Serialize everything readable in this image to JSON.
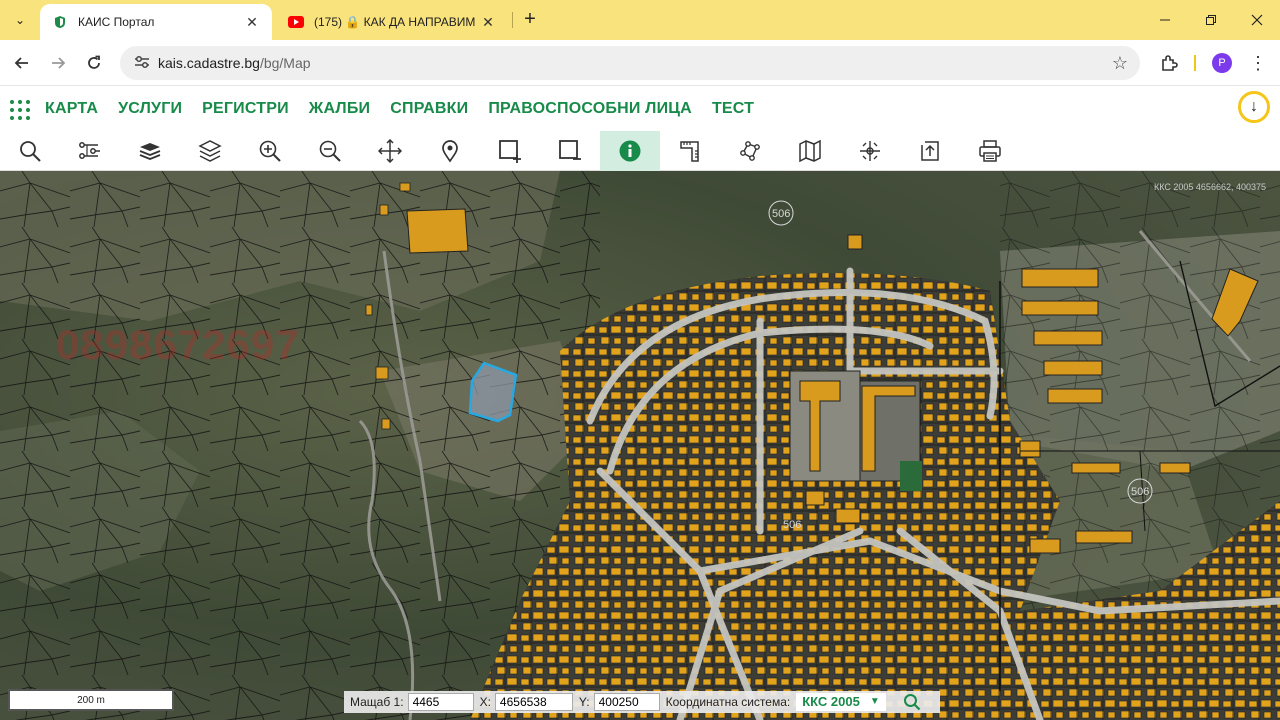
{
  "browser": {
    "tabs": [
      {
        "title": "КАИС Портал",
        "active": true
      },
      {
        "title": "(175) 🔒 КАК ДА НАПРАВИМ",
        "active": false
      }
    ],
    "url_host": "kais.cadastre.bg",
    "url_path": "/bg/Map",
    "profile_initial": "P"
  },
  "site": {
    "menu": [
      "КАРТА",
      "УСЛУГИ",
      "РЕГИСТРИ",
      "ЖАЛБИ",
      "СПРАВКИ",
      "ПРАВОСПОСОБНИ ЛИЦА",
      "ТЕСТ"
    ],
    "accent": "#188a4a"
  },
  "toolbar": {
    "tools": [
      "search-icon",
      "route-icon",
      "layers-stack-icon",
      "layers-icon",
      "zoom-in-icon",
      "zoom-out-icon",
      "pan-icon",
      "location-pin-icon",
      "add-area-icon",
      "remove-area-icon",
      "info-icon",
      "measure-icon",
      "polygon-icon",
      "map-icon",
      "coordinates-icon",
      "export-icon",
      "print-icon"
    ],
    "active_tool": "info-icon"
  },
  "map": {
    "coord_readout": "ККС 2005 4656662, 400375",
    "watermark": "0898672697",
    "scale_bar": "200 m",
    "labels": [
      "506",
      "506",
      "506"
    ],
    "status": {
      "scale_label": "Мащаб 1:",
      "scale_value": "4465",
      "x_label": "X:",
      "x_value": "4656538",
      "y_label": "Y:",
      "y_value": "400250",
      "cs_label": "Координатна система:",
      "cs_value": "ККС 2005"
    }
  }
}
